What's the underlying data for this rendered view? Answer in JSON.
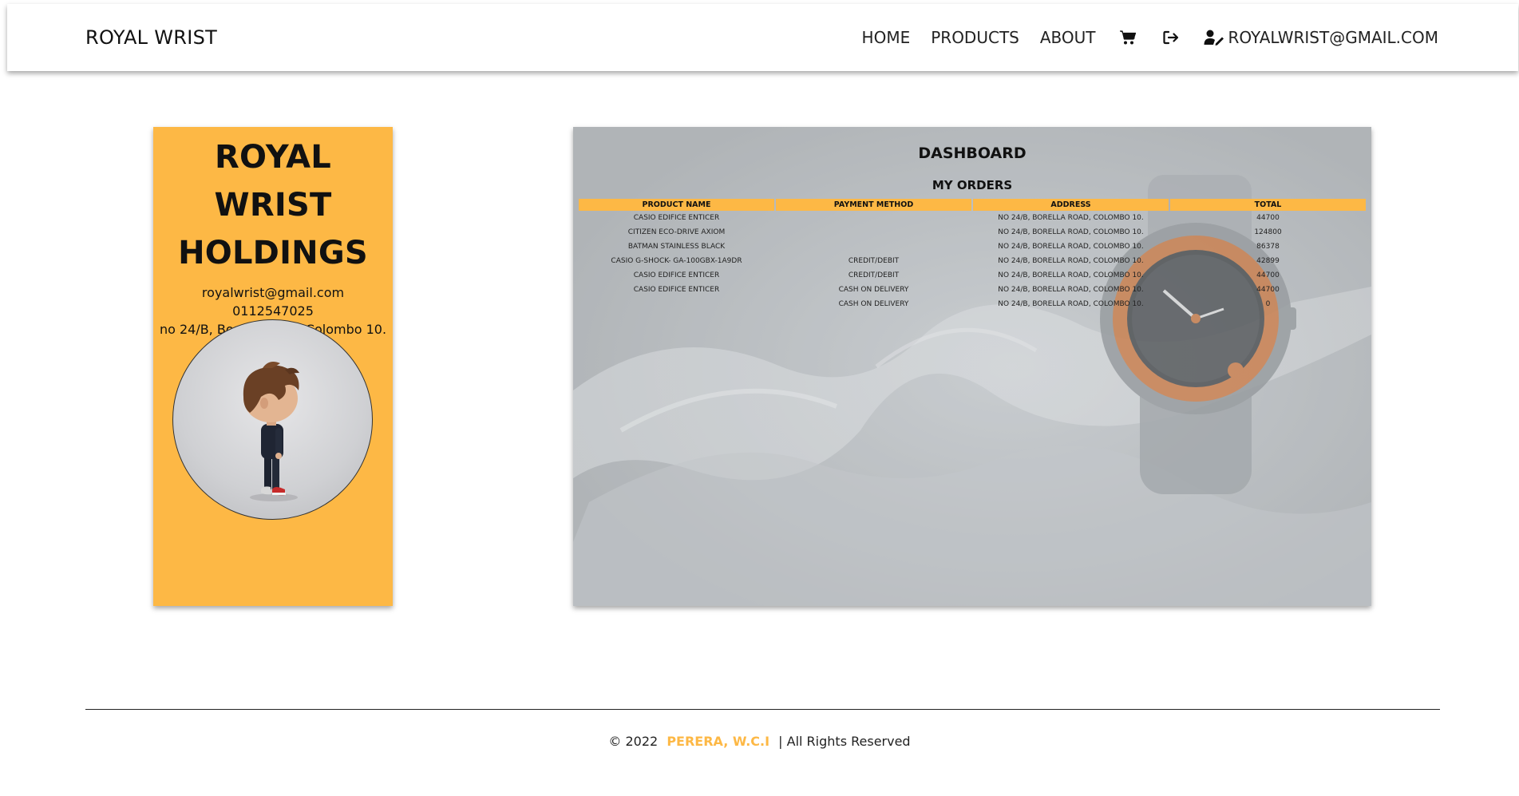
{
  "navbar": {
    "brand": "ROYAL WRIST",
    "links": [
      "HOME",
      "PRODUCTS",
      "ABOUT"
    ],
    "icons": {
      "cart": "cart-icon",
      "logout": "logout-icon",
      "user": "user-edit-icon"
    },
    "user_email": "ROYALWRIST@GMAIL.COM"
  },
  "profile": {
    "company_line1": "ROYAL WRIST",
    "company_line2": "HOLDINGS",
    "email": "royalwrist@gmail.com",
    "phone": "0112547025",
    "address": "no 24/B, Borella Road, Colombo 10."
  },
  "dashboard": {
    "title": "DASHBOARD",
    "subtitle": "MY ORDERS",
    "columns": [
      "PRODUCT NAME",
      "PAYMENT METHOD",
      "ADDRESS",
      "TOTAL"
    ],
    "rows": [
      [
        "CASIO EDIFICE ENTICER",
        "",
        "NO 24/B, BORELLA ROAD, COLOMBO 10.",
        "44700"
      ],
      [
        "CITIZEN ECO-DRIVE AXIOM",
        "",
        "NO 24/B, BORELLA ROAD, COLOMBO 10.",
        "124800"
      ],
      [
        "BATMAN STAINLESS BLACK",
        "",
        "NO 24/B, BORELLA ROAD, COLOMBO 10.",
        "86378"
      ],
      [
        "CASIO G-SHOCK- GA-100GBX-1A9DR",
        "CREDIT/DEBIT",
        "NO 24/B, BORELLA ROAD, COLOMBO 10.",
        "42899"
      ],
      [
        "CASIO EDIFICE ENTICER",
        "CREDIT/DEBIT",
        "NO 24/B, BORELLA ROAD, COLOMBO 10.",
        "44700"
      ],
      [
        "CASIO EDIFICE ENTICER",
        "CASH ON DELIVERY",
        "NO 24/B, BORELLA ROAD, COLOMBO 10.",
        "44700"
      ],
      [
        "",
        "CASH ON DELIVERY",
        "NO 24/B, BORELLA ROAD, COLOMBO 10.",
        "0"
      ]
    ]
  },
  "footer": {
    "copyright": "© 2022",
    "author": "PERERA, W.C.I",
    "rights": "| All Rights Reserved"
  },
  "colors": {
    "accent": "#fdb845",
    "text": "#111111",
    "dashboard_bg": "#b9bcbf"
  }
}
